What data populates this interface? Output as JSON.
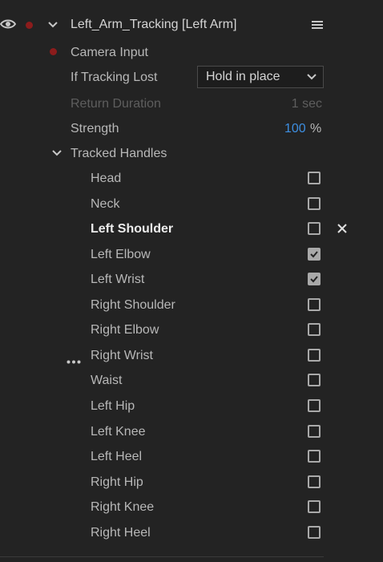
{
  "header": {
    "title": "Left_Arm_Tracking [Left Arm]"
  },
  "props": {
    "camera_input": "Camera Input",
    "if_tracking_lost_label": "If Tracking Lost",
    "if_tracking_lost_value": "Hold in place",
    "return_duration_label": "Return Duration",
    "return_duration_value": "1 sec",
    "strength_label": "Strength",
    "strength_value": "100",
    "strength_unit": "%",
    "tracked_handles_label": "Tracked Handles"
  },
  "handles": [
    {
      "label": "Head",
      "checked": false
    },
    {
      "label": "Neck",
      "checked": false
    },
    {
      "label": "Left Shoulder",
      "checked": false
    },
    {
      "label": "Left Elbow",
      "checked": true
    },
    {
      "label": "Left Wrist",
      "checked": true
    },
    {
      "label": "Right Shoulder",
      "checked": false
    },
    {
      "label": "Right Elbow",
      "checked": false
    },
    {
      "label": "Right Wrist",
      "checked": false
    },
    {
      "label": "Waist",
      "checked": false
    },
    {
      "label": "Left Hip",
      "checked": false
    },
    {
      "label": "Left Knee",
      "checked": false
    },
    {
      "label": "Left Heel",
      "checked": false
    },
    {
      "label": "Right Hip",
      "checked": false
    },
    {
      "label": "Right Knee",
      "checked": false
    },
    {
      "label": "Right Heel",
      "checked": false
    }
  ],
  "colors": {
    "background": "#232323",
    "accent_value": "#3d8ee0",
    "keyframe_dot": "#8c1c1c"
  }
}
